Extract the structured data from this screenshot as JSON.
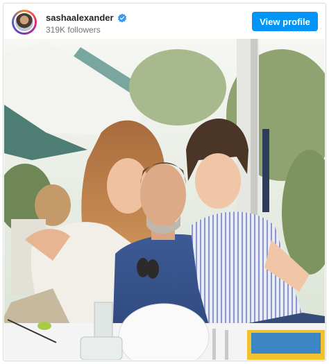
{
  "profile": {
    "username": "sashaalexander",
    "followers": "319K followers",
    "verified": true,
    "avatar_icon": "profile-avatar",
    "verified_icon": "verified-badge-icon"
  },
  "actions": {
    "view_profile_label": "View profile"
  },
  "photo": {
    "subject": "group-portrait-photo"
  },
  "colors": {
    "accent": "#0095f6",
    "verified": "#3897f0"
  }
}
